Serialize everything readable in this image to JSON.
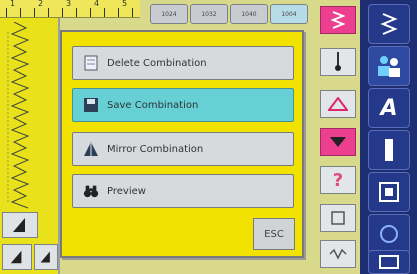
{
  "ruler": {
    "numbers": [
      "1",
      "2",
      "3",
      "4",
      "5"
    ]
  },
  "background_tabs": [
    "1024",
    "1032",
    "1040",
    "1004"
  ],
  "dialog": {
    "items": [
      {
        "label": "Delete Combination",
        "icon": "page-icon",
        "selected": false
      },
      {
        "label": "Save Combination",
        "icon": "save-icon",
        "selected": true
      },
      {
        "label": "Mirror Combination",
        "icon": "mirror-icon",
        "selected": false
      },
      {
        "label": "Preview",
        "icon": "binoculars-icon",
        "selected": false
      }
    ],
    "esc_label": "ESC"
  },
  "colors": {
    "dialog_bg": "#f2e200",
    "selected": "#66d0d4",
    "toolbar": "#1d2e73",
    "pink": "#ec3f8f"
  },
  "toolbar": {
    "items": [
      "stitch-icon",
      "people-icon",
      "letter-a-icon",
      "column-icon",
      "frame-icon",
      "circle-icon",
      "settings-icon"
    ],
    "letter": "A"
  }
}
